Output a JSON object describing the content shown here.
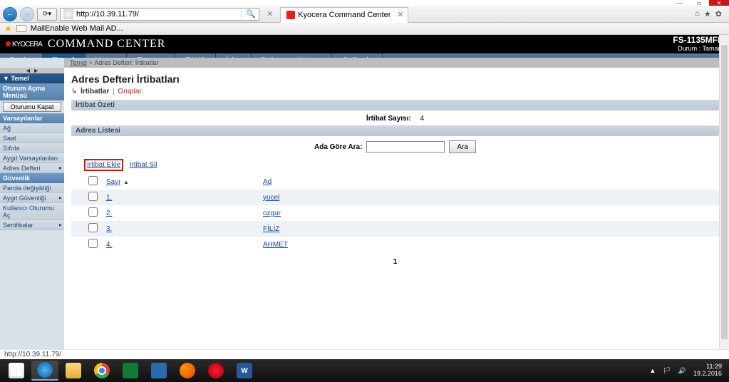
{
  "window": {
    "close_btn": "✕"
  },
  "browser": {
    "url": "http://10.39.11.79/",
    "search_placeholder": "",
    "search_icon": "🔍",
    "tab_title": "Kyocera Command Center",
    "favorites_label": "MailEnable Web Mail AD...",
    "tool_icons": [
      "⌂",
      "★",
      "✿"
    ]
  },
  "header": {
    "brand": "KYOCERA",
    "title": "COMMAND CENTER",
    "model": "FS-1135MFP",
    "status_label": "Durum :",
    "status_value": "Tamam"
  },
  "main_nav": [
    {
      "label": "Başlat",
      "active": false
    },
    {
      "label": "Temel",
      "active": true
    },
    {
      "label": "Yazıcı",
      "active": false
    },
    {
      "label": "Tarayıcı",
      "active": false
    },
    {
      "label": "FAKS",
      "active": false
    },
    {
      "label": "İşler",
      "active": false
    },
    {
      "label": "Dokuman Kutusu",
      "active": false
    },
    {
      "label": "Gelişmiş",
      "active": false
    }
  ],
  "breadcrumb": {
    "root": "Temel",
    "current": "Adres Defteri: İrtibatlar"
  },
  "sidebar": {
    "toggle": "◄ ►",
    "section_temel": "▼ Temel",
    "group_oturum": "Oturum Açma Menüsü",
    "btn_logout": "Oturumu Kapat",
    "group_varsayilan": "Varsayılanlar",
    "items_varsayilan": [
      "Ağ",
      "Saat",
      "Sıfırla",
      "Aygıt Varsayılanları"
    ],
    "item_adres": "Adres Defteri",
    "group_guvenlik": "Güvenlik",
    "items_guvenlik": [
      "Parola değişikliği"
    ],
    "item_aygit_guv": "Aygıt Güvenliği",
    "item_kullanici": "Kullanıcı Oturumu Aç",
    "item_sertifikalar": "Sertifikalar"
  },
  "content": {
    "page_title": "Adres Defteri İrtibatları",
    "subtabs": {
      "arrow": "↳",
      "active": "İrtibatlar",
      "sep": "|",
      "link": "Gruplar"
    },
    "section_summary": "İrtibat Özeti",
    "summary_label": "İrtibat Sayısı:",
    "summary_value": "4",
    "section_list": "Adres Listesi",
    "search_label": "Ada Göre Ara:",
    "search_btn": "Ara",
    "action_add": "İrtibat Ekle",
    "action_delete": "İrtibat Sil",
    "col_number": "Sayı",
    "col_name": "Ad",
    "rows": [
      {
        "num": "1.",
        "name": "yucel"
      },
      {
        "num": "2.",
        "name": "ozgur"
      },
      {
        "num": "3.",
        "name": "FİLİZ"
      },
      {
        "num": "4.",
        "name": "AHMET"
      }
    ],
    "pagination": "1"
  },
  "footer": {
    "status": "http://10.39.11.79/"
  },
  "taskbar": {
    "time": "11:29",
    "date": "19.2.2016",
    "tray": [
      "▲",
      "🏳",
      "🔊"
    ]
  }
}
